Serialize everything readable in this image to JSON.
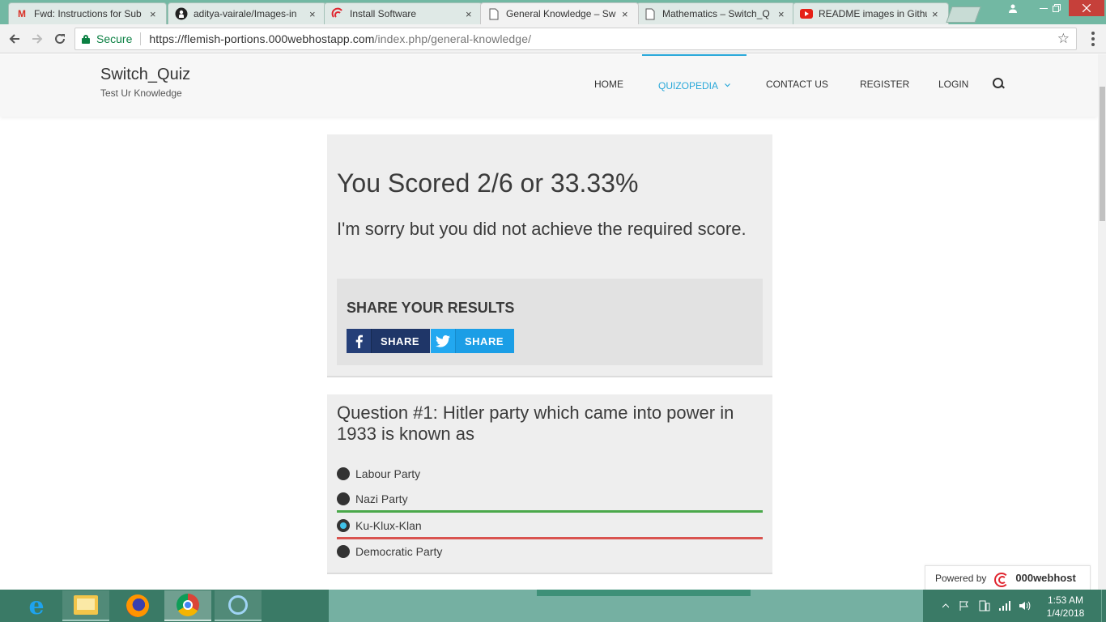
{
  "browser": {
    "tabs": [
      {
        "label": "Fwd: Instructions for Sub",
        "icon": "gmail-icon",
        "active": false
      },
      {
        "label": "aditya-vairale/Images-in",
        "icon": "github-icon",
        "active": false
      },
      {
        "label": "Install Software",
        "icon": "site-icon",
        "active": false
      },
      {
        "label": "General Knowledge – Sw",
        "icon": "page-icon",
        "active": true
      },
      {
        "label": "Mathematics – Switch_Q",
        "icon": "page-icon",
        "active": false
      },
      {
        "label": "README images in Githu",
        "icon": "youtube-icon",
        "active": false
      }
    ],
    "close_glyph": "×",
    "secure_label": "Secure",
    "url_host": "https://flemish-portions.000webhostapp.com",
    "url_path": "/index.php/general-knowledge/"
  },
  "site": {
    "name": "Switch_Quiz",
    "tagline": "Test Ur Knowledge",
    "nav": {
      "home": "HOME",
      "quizopedia": "QUIZOPEDIA",
      "contact": "CONTACT US",
      "register": "REGISTER",
      "login": "LOGIN"
    },
    "accent_color": "#29a8d9"
  },
  "result": {
    "score_text": "You Scored 2/6 or 33.33%",
    "message": "I'm sorry but you did not achieve the required score.",
    "share_title": "SHARE YOUR RESULTS",
    "facebook_label": "SHARE",
    "twitter_label": "SHARE"
  },
  "question": {
    "title": "Question #1: Hitler party which came into power in 1933 is known as",
    "answers": [
      {
        "label": "Labour Party",
        "selected": false,
        "status": "none"
      },
      {
        "label": "Nazi Party",
        "selected": false,
        "status": "correct"
      },
      {
        "label": "Ku-Klux-Klan",
        "selected": true,
        "status": "wrong"
      },
      {
        "label": "Democratic Party",
        "selected": false,
        "status": "none"
      }
    ],
    "correct_color": "#4aa84a",
    "wrong_color": "#d9534f"
  },
  "badge": {
    "powered_by": "Powered by",
    "brand": "000webhost"
  },
  "taskbar": {
    "time": "1:53 AM",
    "date": "1/4/2018"
  }
}
